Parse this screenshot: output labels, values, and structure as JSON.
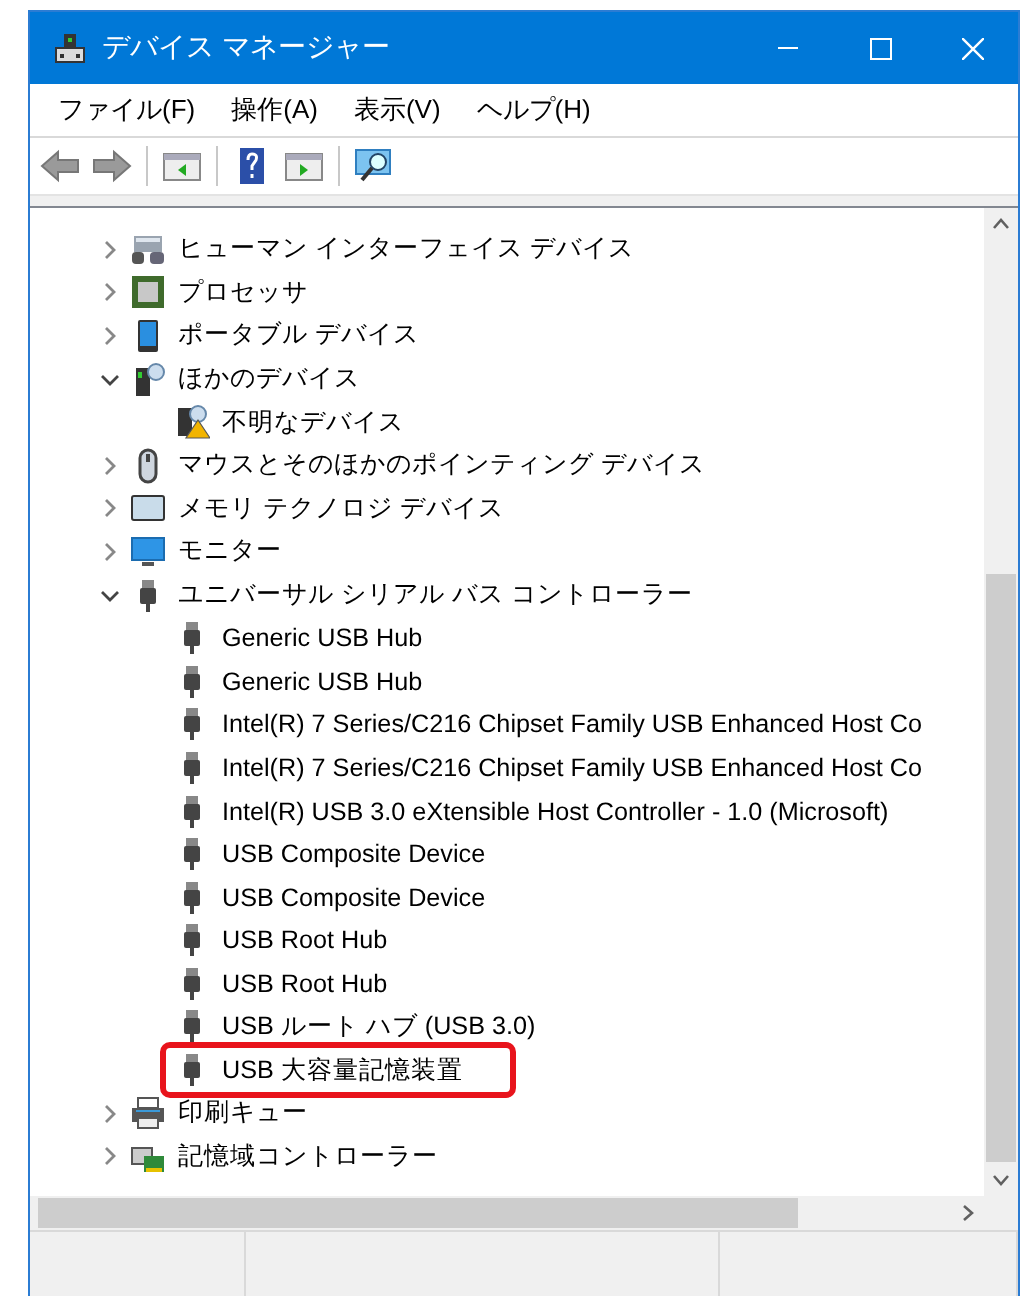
{
  "window": {
    "title": "デバイス マネージャー"
  },
  "menu": [
    "ファイル(F)",
    "操作(A)",
    "表示(V)",
    "ヘルプ(H)"
  ],
  "tree": [
    {
      "label": "ヒューマン インターフェイス デバイス",
      "kind": "hid",
      "expanded": false
    },
    {
      "label": "プロセッサ",
      "kind": "cpu",
      "expanded": false
    },
    {
      "label": "ポータブル デバイス",
      "kind": "portable",
      "expanded": false
    },
    {
      "label": "ほかのデバイス",
      "kind": "other",
      "expanded": true,
      "children": [
        {
          "label": "不明なデバイス",
          "kind": "unknown"
        }
      ]
    },
    {
      "label": "マウスとそのほかのポインティング デバイス",
      "kind": "mouse",
      "expanded": false
    },
    {
      "label": "メモリ テクノロジ デバイス",
      "kind": "memory",
      "expanded": false
    },
    {
      "label": "モニター",
      "kind": "monitor",
      "expanded": false
    },
    {
      "label": "ユニバーサル シリアル バス コントローラー",
      "kind": "usb",
      "expanded": true,
      "children": [
        {
          "label": "Generic USB Hub",
          "kind": "usb",
          "highlighted": false
        },
        {
          "label": "Generic USB Hub",
          "kind": "usb",
          "highlighted": false
        },
        {
          "label": "Intel(R) 7 Series/C216 Chipset Family USB Enhanced Host Co",
          "kind": "usb",
          "highlighted": false
        },
        {
          "label": "Intel(R) 7 Series/C216 Chipset Family USB Enhanced Host Co",
          "kind": "usb",
          "highlighted": false
        },
        {
          "label": "Intel(R) USB 3.0 eXtensible Host Controller - 1.0 (Microsoft)",
          "kind": "usb",
          "highlighted": false
        },
        {
          "label": "USB Composite Device",
          "kind": "usb",
          "highlighted": false
        },
        {
          "label": "USB Composite Device",
          "kind": "usb",
          "highlighted": false
        },
        {
          "label": "USB Root Hub",
          "kind": "usb",
          "highlighted": false
        },
        {
          "label": "USB Root Hub",
          "kind": "usb",
          "highlighted": false
        },
        {
          "label": "USB ルート ハブ (USB 3.0)",
          "kind": "usb",
          "highlighted": false
        },
        {
          "label": "USB 大容量記憶装置",
          "kind": "usb",
          "highlighted": true
        }
      ]
    },
    {
      "label": "印刷キュー",
      "kind": "printer",
      "expanded": false
    },
    {
      "label": "記憶域コントローラー",
      "kind": "storage",
      "expanded": false
    }
  ]
}
